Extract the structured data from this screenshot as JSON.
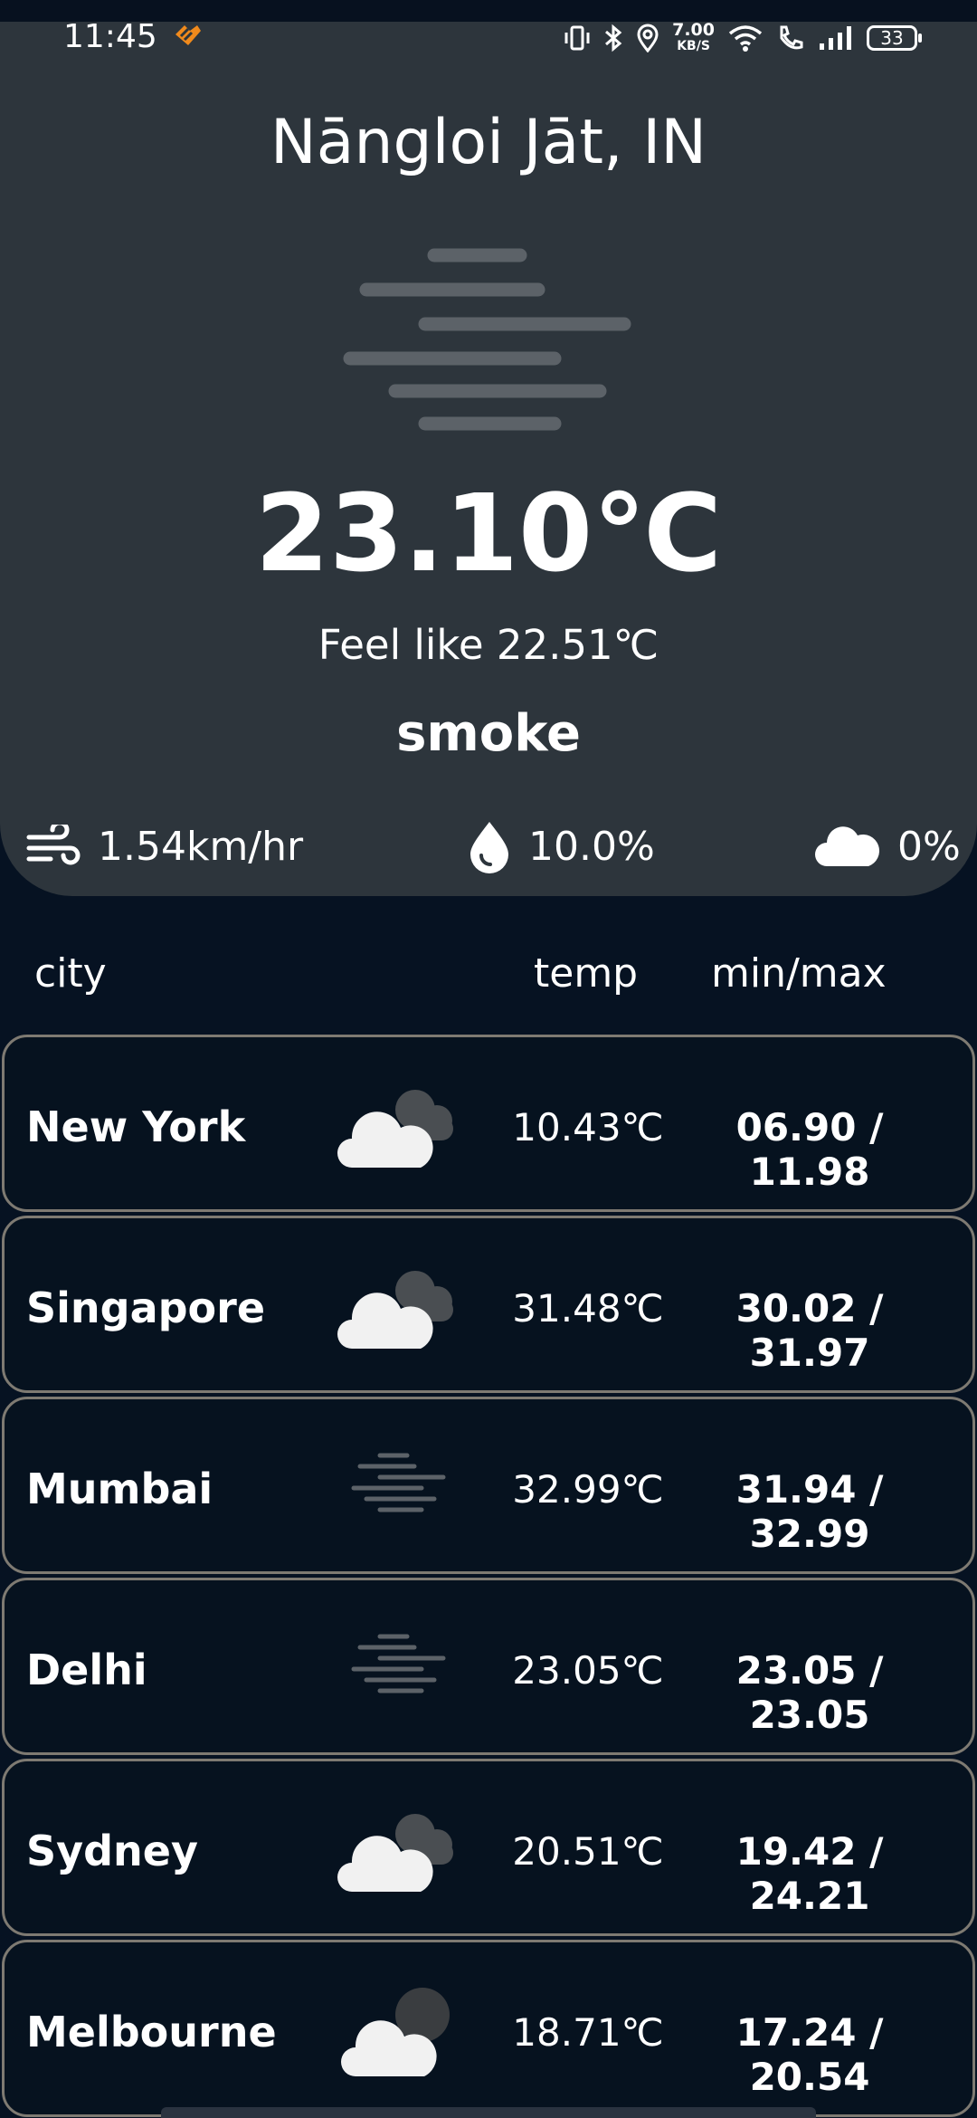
{
  "status_bar": {
    "time": "11:45",
    "net_speed_value": "7.00",
    "net_speed_unit": "KB/S",
    "battery": "33"
  },
  "current": {
    "location": "Nāngloi Jāt, IN",
    "temperature": "23.10℃",
    "feels_like": "Feel like 22.51℃",
    "condition": "smoke",
    "condition_icon": "smoke-icon",
    "wind": "1.54km/hr",
    "humidity": "10.0%",
    "clouds": "0%"
  },
  "list_header": {
    "city": "city",
    "temp": "temp",
    "minmax": "min/max"
  },
  "cities": [
    {
      "name": "New York",
      "icon": "cloudy-icon",
      "temp": "10.43℃",
      "minmax": "06.90 / 11.98"
    },
    {
      "name": "Singapore",
      "icon": "cloudy-icon",
      "temp": "31.48℃",
      "minmax": "30.02 / 31.97"
    },
    {
      "name": "Mumbai",
      "icon": "smoke-icon",
      "temp": "32.99℃",
      "minmax": "31.94 / 32.99"
    },
    {
      "name": "Delhi",
      "icon": "smoke-icon",
      "temp": "23.05℃",
      "minmax": "23.05 / 23.05"
    },
    {
      "name": "Sydney",
      "icon": "cloudy-icon",
      "temp": "20.51℃",
      "minmax": "19.42 / 24.21"
    },
    {
      "name": "Melbourne",
      "icon": "cloudy-night-icon",
      "temp": "18.71℃",
      "minmax": "17.24 / 20.54"
    }
  ],
  "colors": {
    "background": "#061222",
    "hero_panel": "#2d353c",
    "card_border": "#7e7a72"
  }
}
